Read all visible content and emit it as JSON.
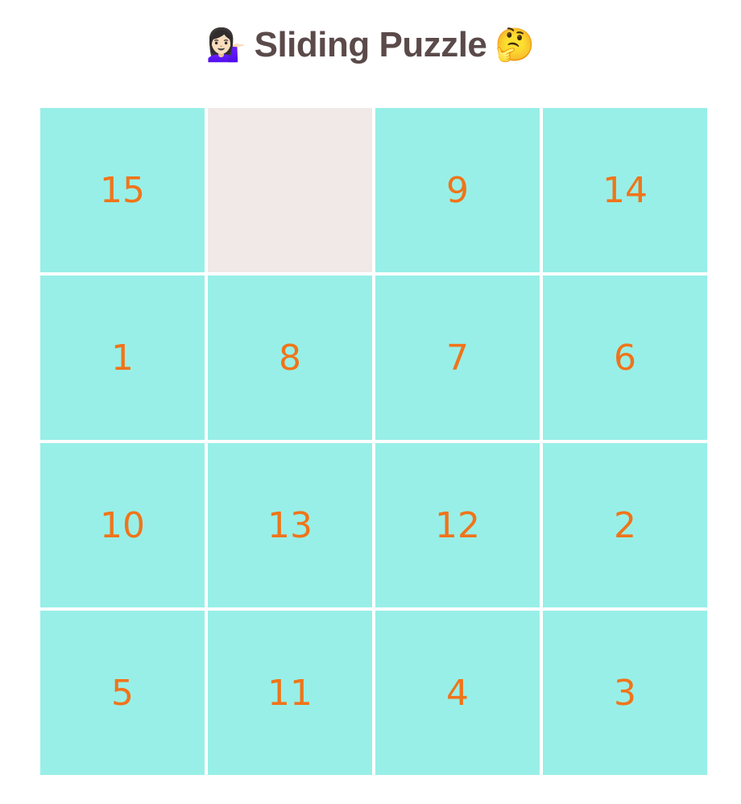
{
  "header": {
    "left_emoji": "💁🏻‍♀️",
    "title": "Sliding Puzzle",
    "right_emoji": "🤔"
  },
  "board": {
    "tiles": [
      "15",
      "",
      "9",
      "14",
      "1",
      "8",
      "7",
      "6",
      "10",
      "13",
      "12",
      "2",
      "5",
      "11",
      "4",
      "3"
    ]
  },
  "colors": {
    "tile_bg": "#98efe7",
    "empty_bg": "#f1e8e8",
    "number": "#f07419",
    "title": "#5b4a4a"
  }
}
